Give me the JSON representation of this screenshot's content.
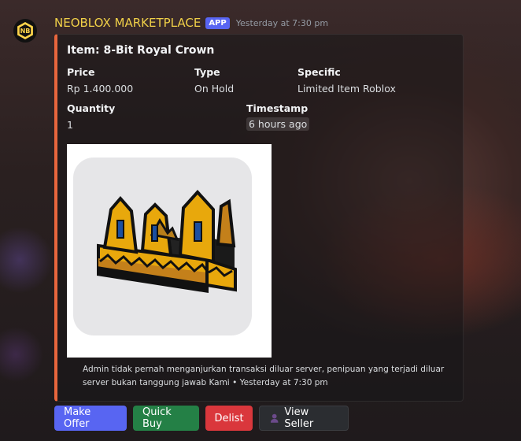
{
  "message": {
    "username": "NEOBLOX MARKETPLACE",
    "badge": "APP",
    "timestamp": "Yesterday at 7:30 pm",
    "avatar_icon": "neoblox-logo-icon",
    "avatar_letters": "NB"
  },
  "embed": {
    "accent_color": "#e8663d",
    "title": "Item: 8-Bit Royal Crown",
    "fields": {
      "price_label": "Price",
      "price_value": "Rp 1.400.000",
      "type_label": "Type",
      "type_value": "On Hold",
      "specific_label": "Specific",
      "specific_value": "Limited Item Roblox",
      "quantity_label": "Quantity",
      "quantity_value": "1",
      "timestamp_label": "Timestamp",
      "timestamp_value": "6 hours ago"
    },
    "image_icon": "8-bit-royal-crown-image",
    "footer_text": "Admin tidak pernah menganjurkan transaksi diluar server, penipuan yang terjadi diluar server bukan tanggung jawab Kami",
    "footer_timestamp": "Yesterday at 7:30 pm",
    "footer_separator": "•"
  },
  "buttons": {
    "make_offer": "Make Offer",
    "quick_buy": "Quick Buy",
    "delist": "Delist",
    "view_seller": "View Seller",
    "view_seller_icon": "person-icon"
  },
  "colors": {
    "username": "#f0d048",
    "blurple": "#5865f2",
    "green": "#248046",
    "red": "#da373c",
    "grey": "#2b2d31"
  }
}
